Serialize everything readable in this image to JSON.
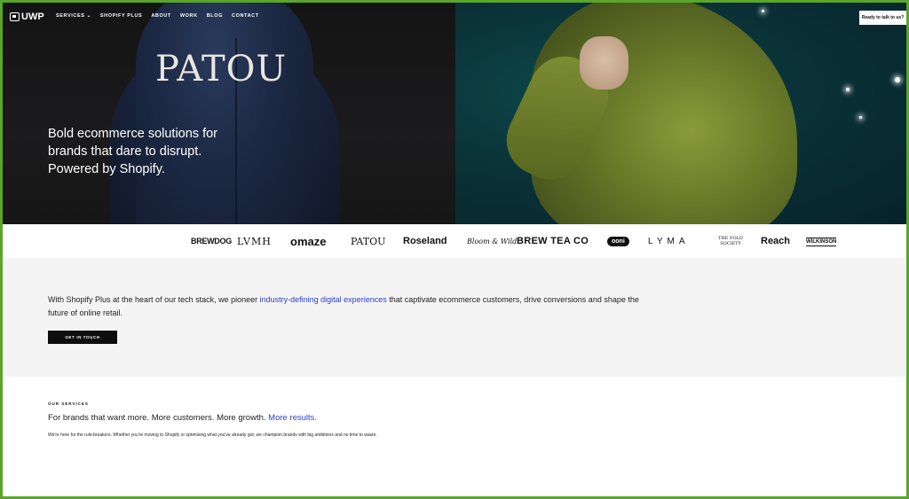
{
  "nav": {
    "logo": "UWP",
    "links": [
      "SERVICES",
      "SHOPIFY PLUS",
      "ABOUT",
      "WORK",
      "BLOG",
      "CONTACT"
    ],
    "services_caret": "⌄",
    "cta": "Ready to talk to us?"
  },
  "hero": {
    "coat_print": "PATOU",
    "headline_lines": [
      "Bold ecommerce solutions for",
      "brands that dare to disrupt.",
      "Powered by Shopify."
    ]
  },
  "logos": {
    "items": [
      "BREWDOG",
      "LVMH",
      "omaze",
      "PATOU",
      "Roseland",
      "Bloom & Wild",
      "BREW TEA CO",
      "ooni",
      "LYMA",
      "THE FOLD SOCIETY",
      "Reach",
      "WILKINSON"
    ]
  },
  "intro": {
    "text_before": "With Shopify Plus at the heart of our tech stack, we pioneer ",
    "text_highlight": "industry-defining digital experiences",
    "text_after": " that captivate ecommerce customers, drive conversions and shape the future of online retail.",
    "button": "GET IN TOUCH",
    "highlight_color": "#2b3fc7"
  },
  "services": {
    "label": "OUR SERVICES",
    "heading_before": "For brands that want more. More customers. More growth. ",
    "heading_highlight": "More results.",
    "body": "We're here for the rule-breakers. Whether you're moving to Shopify or optimising what you've already got, we champion brands with big ambitions and no time to waste."
  },
  "colors": {
    "frame": "#5aa52c",
    "button_bg": "#0e0e0e",
    "section_bg": "#f4f4f4"
  }
}
